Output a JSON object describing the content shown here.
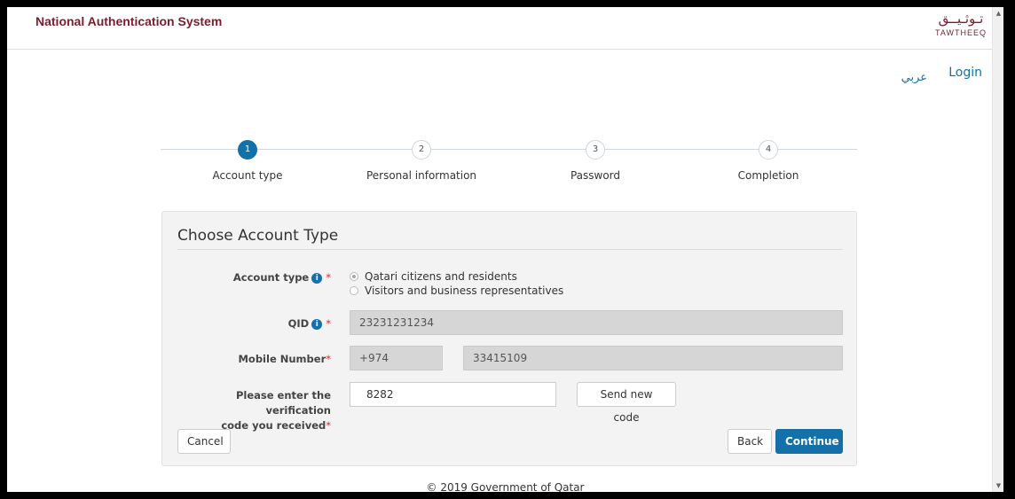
{
  "header": {
    "brand": "National Authentication System",
    "logo_arabic": "تـوثـيــق",
    "logo_latin": "TAWTHEEQ"
  },
  "nav": {
    "lang": "عربي",
    "login": "Login"
  },
  "stepper": {
    "steps": [
      {
        "number": "1",
        "label": "Account type"
      },
      {
        "number": "2",
        "label": "Personal information"
      },
      {
        "number": "3",
        "label": "Password"
      },
      {
        "number": "4",
        "label": "Completion"
      }
    ],
    "active": 1
  },
  "form": {
    "title": "Choose Account Type",
    "account_type": {
      "label": "Account type",
      "options": [
        "Qatari citizens and residents",
        "Visitors and business representatives"
      ],
      "selected": 0
    },
    "qid": {
      "label": "QID",
      "value": "23231231234"
    },
    "mobile": {
      "label": "Mobile Number",
      "country_code": "+974",
      "number": "33415109"
    },
    "verification": {
      "label_line1": "Please enter the verification",
      "label_line2": "code you received",
      "value": "8282",
      "send_new_code": "Send new code"
    },
    "buttons": {
      "cancel": "Cancel",
      "back": "Back",
      "continue": "Continue"
    }
  },
  "footer": {
    "copyright": "© 2019 Government of Qatar"
  },
  "colors": {
    "brand": "#7a1d2e",
    "accent": "#1470a8"
  }
}
